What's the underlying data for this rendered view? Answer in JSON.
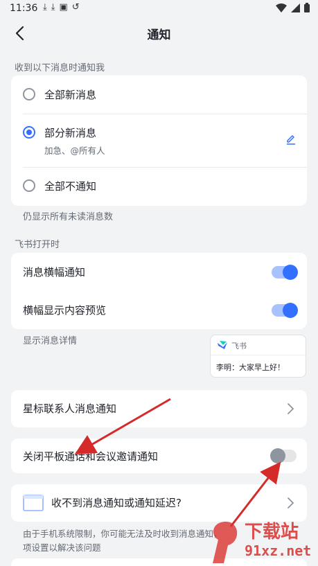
{
  "status_bar": {
    "time": "11:36",
    "left_icons": [
      "download-icon",
      "download-icon",
      "app-icon",
      "sync-icon"
    ],
    "right_icons": [
      "wifi-icon",
      "signal-icon",
      "battery-icon"
    ]
  },
  "header": {
    "title": "通知"
  },
  "section1": {
    "label": "收到以下消息时通知我",
    "options": [
      {
        "label": "全部新消息",
        "selected": false
      },
      {
        "label": "部分新消息",
        "selected": true,
        "sub": "加急、@所有人"
      },
      {
        "label": "全部不通知",
        "selected": false
      }
    ],
    "note": "仍显示所有未读消息数"
  },
  "section2": {
    "label": "飞书打开时",
    "toggles": [
      {
        "label": "消息横幅通知",
        "on": true
      },
      {
        "label": "横幅显示内容预览",
        "on": true
      }
    ],
    "note": "显示消息详情",
    "preview": {
      "app_name": "飞书",
      "message": "李明：大家早上好！"
    }
  },
  "star_contacts": {
    "label": "星标联系人消息通知"
  },
  "tablet_calls": {
    "label": "关闭平板通话和会议邀请通知",
    "on": false
  },
  "help": {
    "label": "收不到消息通知或通知延迟?",
    "note_line1": "由于手机系统限制，你可能无法及时收到消息通知，",
    "note_line2": "项设置以解决该问题"
  },
  "colors": {
    "accent": "#3370ff",
    "background": "#f2f3f5",
    "annotation_arrow": "#d42a2a"
  },
  "watermark": {
    "text": "下载站",
    "domain": "91xz.net"
  }
}
